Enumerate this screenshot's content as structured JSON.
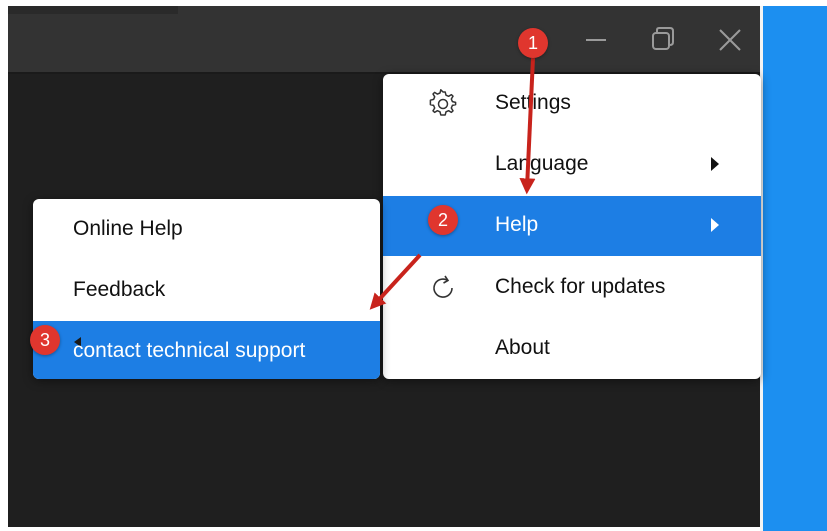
{
  "window": {
    "controls": {
      "minimize_icon": "minimize-icon",
      "restore_icon": "restore-icon",
      "close_icon": "close-icon"
    }
  },
  "main_menu": {
    "items": [
      {
        "label": "Settings",
        "icon": "gear-icon",
        "has_submenu": false
      },
      {
        "label": "Language",
        "icon": "",
        "has_submenu": true
      },
      {
        "label": "Help",
        "icon": "",
        "has_submenu": true,
        "highlighted": true
      },
      {
        "label": "Check for updates",
        "icon": "refresh-icon",
        "has_submenu": false
      },
      {
        "label": "About",
        "icon": "",
        "has_submenu": false
      }
    ]
  },
  "help_submenu": {
    "items": [
      {
        "label": "Online Help"
      },
      {
        "label": "Feedback"
      },
      {
        "label": "contact technical support",
        "highlighted": true
      }
    ]
  },
  "annotations": {
    "steps": [
      "1",
      "2",
      "3"
    ],
    "badge_color": "#e0362e",
    "arrow_color": "#c8231c"
  },
  "colors": {
    "titlebar": "#333333",
    "window_body": "#1f1f1f",
    "highlight": "#1d7ee4",
    "desktop": "#1c8ff0"
  }
}
